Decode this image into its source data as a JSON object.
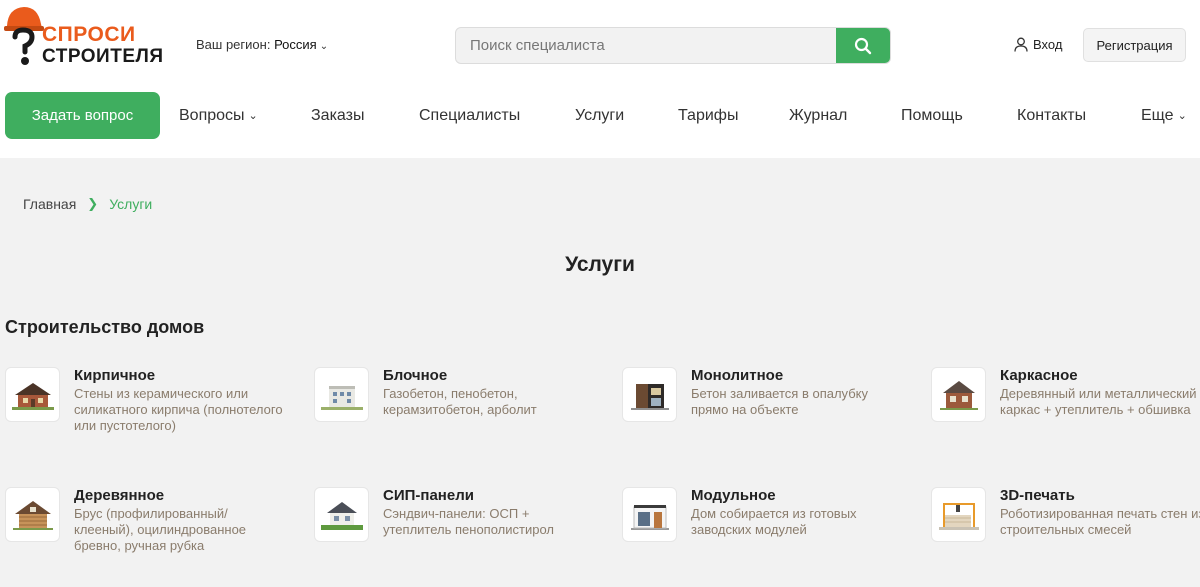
{
  "logo": {
    "line1": "СПРОСИ",
    "line2": "СТРОИТЕЛЯ"
  },
  "region": {
    "label": "Ваш регион:",
    "value": "Россия"
  },
  "search": {
    "placeholder": "Поиск специалиста"
  },
  "auth": {
    "login": "Вход",
    "register": "Регистрация"
  },
  "ask_button": "Задать вопрос",
  "nav": [
    "Вопросы",
    "Заказы",
    "Специалисты",
    "Услуги",
    "Тарифы",
    "Журнал",
    "Помощь",
    "Контакты",
    "Еще"
  ],
  "breadcrumb": {
    "home": "Главная",
    "current": "Услуги"
  },
  "page_title": "Услуги",
  "section": {
    "title": "Строительство домов",
    "items": [
      {
        "title": "Кирпичное",
        "desc": "Стены из керамического или силикатного кирпича (полнотелого или пустотелого)",
        "icon": "brick-house-icon"
      },
      {
        "title": "Блочное",
        "desc": "Газобетон, пенобетон, керамзитобетон, арболит",
        "icon": "block-house-icon"
      },
      {
        "title": "Монолитное",
        "desc": "Бетон заливается в опалубку прямо на объекте",
        "icon": "monolithic-house-icon"
      },
      {
        "title": "Каркасное",
        "desc": "Деревянный или металлический каркас + утеплитель + обшивка",
        "icon": "frame-house-icon"
      },
      {
        "title": "Деревянное",
        "desc": "Брус (профилированный/клееный), оцилиндрованное бревно, ручная рубка",
        "icon": "wooden-house-icon"
      },
      {
        "title": "СИП-панели",
        "desc": "Сэндвич-панели: ОСП + утеплитель пенополистирол",
        "icon": "sip-house-icon"
      },
      {
        "title": "Модульное",
        "desc": "Дом собирается из готовых заводских модулей",
        "icon": "modular-house-icon"
      },
      {
        "title": "3D-печать",
        "desc": "Роботизированная печать стен из строительных смесей",
        "icon": "3d-printed-house-icon"
      }
    ]
  },
  "colors": {
    "accent": "#3fae5f",
    "logo_orange": "#ea5b1c",
    "desc_text": "#8a7c6c",
    "page_bg": "#f2f2f2"
  }
}
